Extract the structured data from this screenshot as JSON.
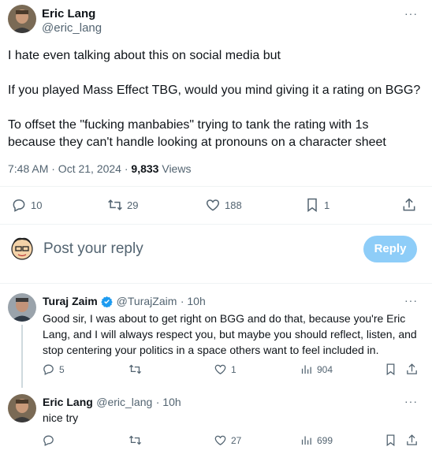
{
  "main_tweet": {
    "author_name": "Eric Lang",
    "author_handle": "@eric_lang",
    "more": "···",
    "text": "I hate even talking about this on social media but\n\nIf you played Mass Effect TBG, would you mind giving it a rating on BGG?\n\nTo offset the \"fucking manbabies\" trying to tank the rating with 1s\nbecause they can't handle looking at pronouns on a character sheet",
    "timestamp": "7:48 AM · Oct 21, 2024 · ",
    "views_count": "9,833",
    "views_label": "Views",
    "actions": {
      "replies": "10",
      "retweets": "29",
      "likes": "188",
      "bookmarks": "1"
    }
  },
  "composer": {
    "placeholder": "Post your reply",
    "button_label": "Reply"
  },
  "replies": [
    {
      "author_name": "Turaj Zaim",
      "author_handle": "@TurajZaim",
      "time": "· 10h",
      "more": "···",
      "text": "Good sir, I was about to get right on BGG and do that, because you're Eric Lang, and I will always respect you, but maybe you should reflect, listen, and stop centering your politics in a space others want to feel included in.",
      "replies": "5",
      "retweets": "",
      "likes": "1",
      "views": "904"
    },
    {
      "author_name": "Eric Lang",
      "author_handle": "@eric_lang",
      "time": "· 10h",
      "more": "···",
      "text": "nice try",
      "replies": "",
      "retweets": "",
      "likes": "27",
      "views": "699"
    }
  ],
  "colors": {
    "text": "#0f1419",
    "secondary": "#536471",
    "reply_button": "#8ecdf8",
    "verified": "#1d9bf0"
  }
}
